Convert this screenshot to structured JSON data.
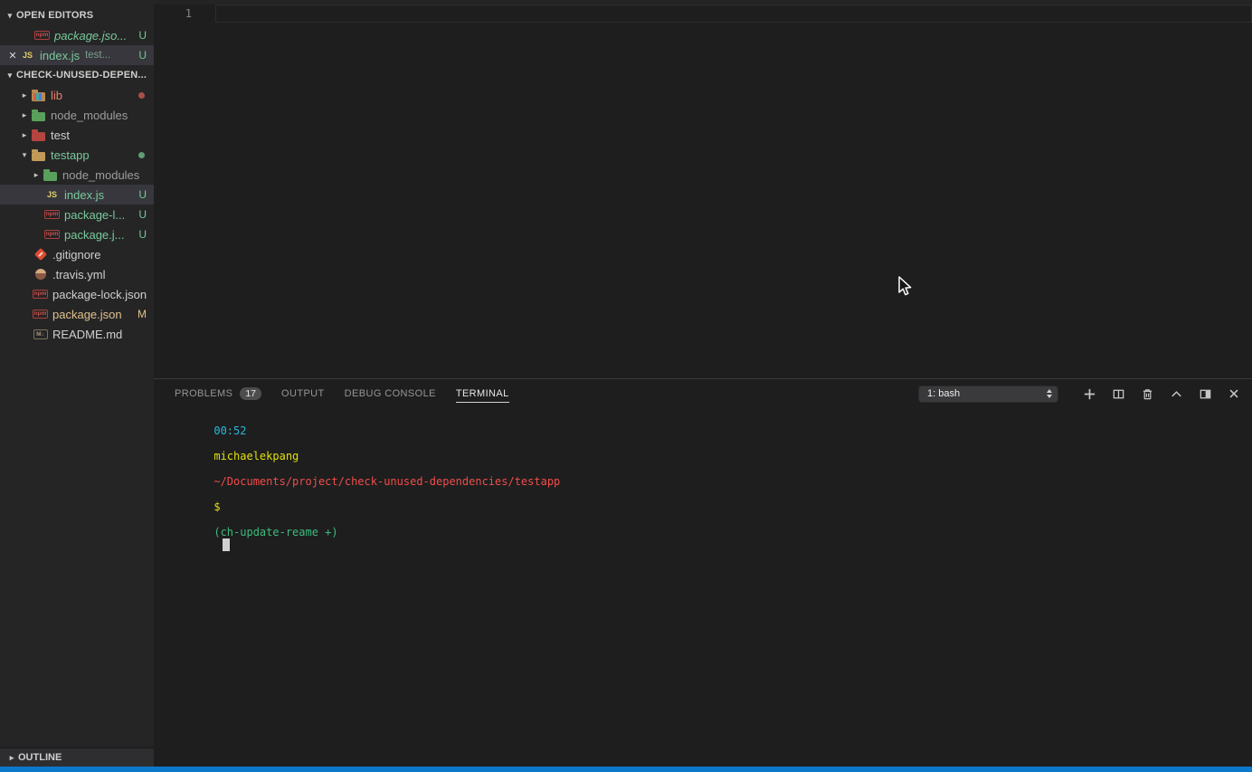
{
  "sidebar": {
    "open_editors": {
      "header": "OPEN EDITORS",
      "items": [
        {
          "name": "package.jso...",
          "badge": "U"
        },
        {
          "name": "index.js",
          "description": "test...",
          "badge": "U"
        }
      ]
    },
    "explorer": {
      "header": "CHECK-UNUSED-DEPEN...",
      "items": [
        {
          "name": "lib"
        },
        {
          "name": "node_modules"
        },
        {
          "name": "test"
        },
        {
          "name": "testapp"
        },
        {
          "name": "node_modules"
        },
        {
          "name": "index.js",
          "badge": "U"
        },
        {
          "name": "package-l...",
          "badge": "U"
        },
        {
          "name": "package.j...",
          "badge": "U"
        },
        {
          "name": ".gitignore"
        },
        {
          "name": ".travis.yml"
        },
        {
          "name": "package-lock.json"
        },
        {
          "name": "package.json",
          "badge": "M"
        },
        {
          "name": "README.md"
        }
      ]
    },
    "outline": {
      "header": "OUTLINE"
    }
  },
  "editor": {
    "line_number": "1"
  },
  "panel": {
    "tabs": [
      {
        "label": "PROBLEMS",
        "badge": "17"
      },
      {
        "label": "OUTPUT"
      },
      {
        "label": "DEBUG CONSOLE"
      },
      {
        "label": "TERMINAL"
      }
    ],
    "shell_selector": {
      "value": "1: bash"
    },
    "terminal_line": {
      "time": "00:52",
      "user": "michaelekpang",
      "path": "~/Documents/project/check-unused-dependencies/testapp",
      "prompt": "$",
      "git_status": "(ch-update-reame +)"
    }
  },
  "icons": {
    "twisty_expanded": "▾",
    "twisty_collapsed": "▸",
    "close": "✕",
    "npm_label": "npm",
    "js_label": "JS",
    "md_label": "M↓"
  },
  "colors": {
    "status_bar": "#0a79cc",
    "git_untracked": "#73c991",
    "git_modified": "#e2c08d",
    "terminal_cyan": "#29b8db",
    "terminal_yellow": "#e0e010",
    "terminal_red": "#f14c4c",
    "terminal_green": "#3dbb7d",
    "selection_bg": "#37373d"
  }
}
